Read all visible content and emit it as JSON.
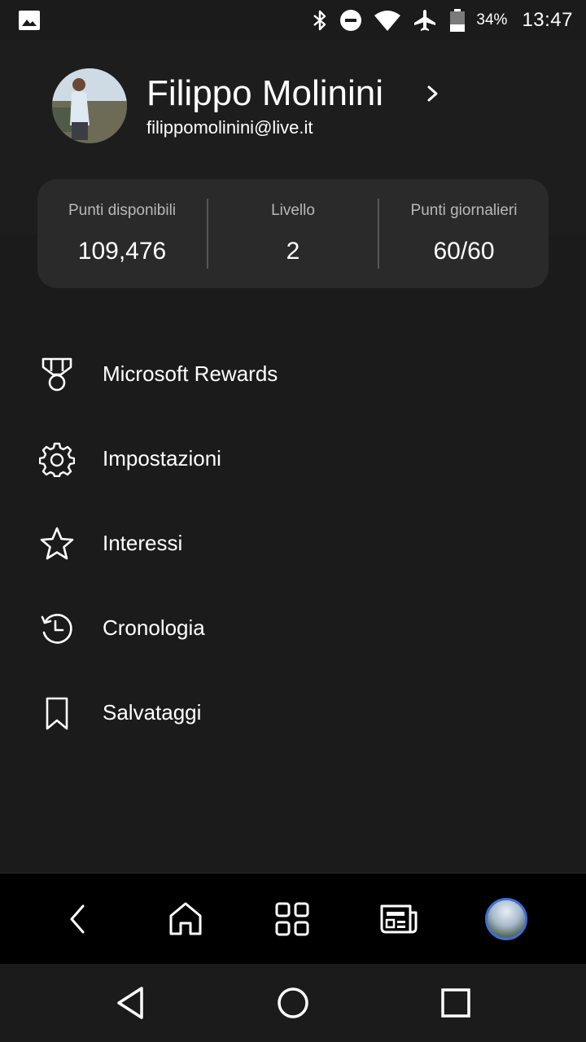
{
  "status_bar": {
    "icons": [
      "image-icon",
      "bluetooth-icon",
      "do-not-disturb-icon",
      "wifi-icon",
      "airplane-icon",
      "battery-icon"
    ],
    "battery": "34%",
    "time": "13:47"
  },
  "profile": {
    "name": "Filippo Molinini",
    "email": "filippomolinini@live.it"
  },
  "stats": [
    {
      "label": "Punti disponibili",
      "value": "109,476"
    },
    {
      "label": "Livello",
      "value": "2"
    },
    {
      "label": "Punti giornalieri",
      "value": "60/60"
    }
  ],
  "menu": [
    {
      "label": "Microsoft Rewards",
      "icon": "medal-icon"
    },
    {
      "label": "Impostazioni",
      "icon": "gear-icon"
    },
    {
      "label": "Interessi",
      "icon": "star-icon"
    },
    {
      "label": "Cronologia",
      "icon": "history-icon"
    },
    {
      "label": "Salvataggi",
      "icon": "bookmark-icon"
    }
  ],
  "bottom_nav": [
    "back-icon",
    "home-icon",
    "apps-grid-icon",
    "news-icon",
    "profile-avatar"
  ],
  "system_nav": [
    "system-back-icon",
    "system-home-icon",
    "system-recents-icon"
  ],
  "colors": {
    "background": "#1b1b1b",
    "card": "#2a2a2a",
    "accent": "#3f6fd6"
  }
}
